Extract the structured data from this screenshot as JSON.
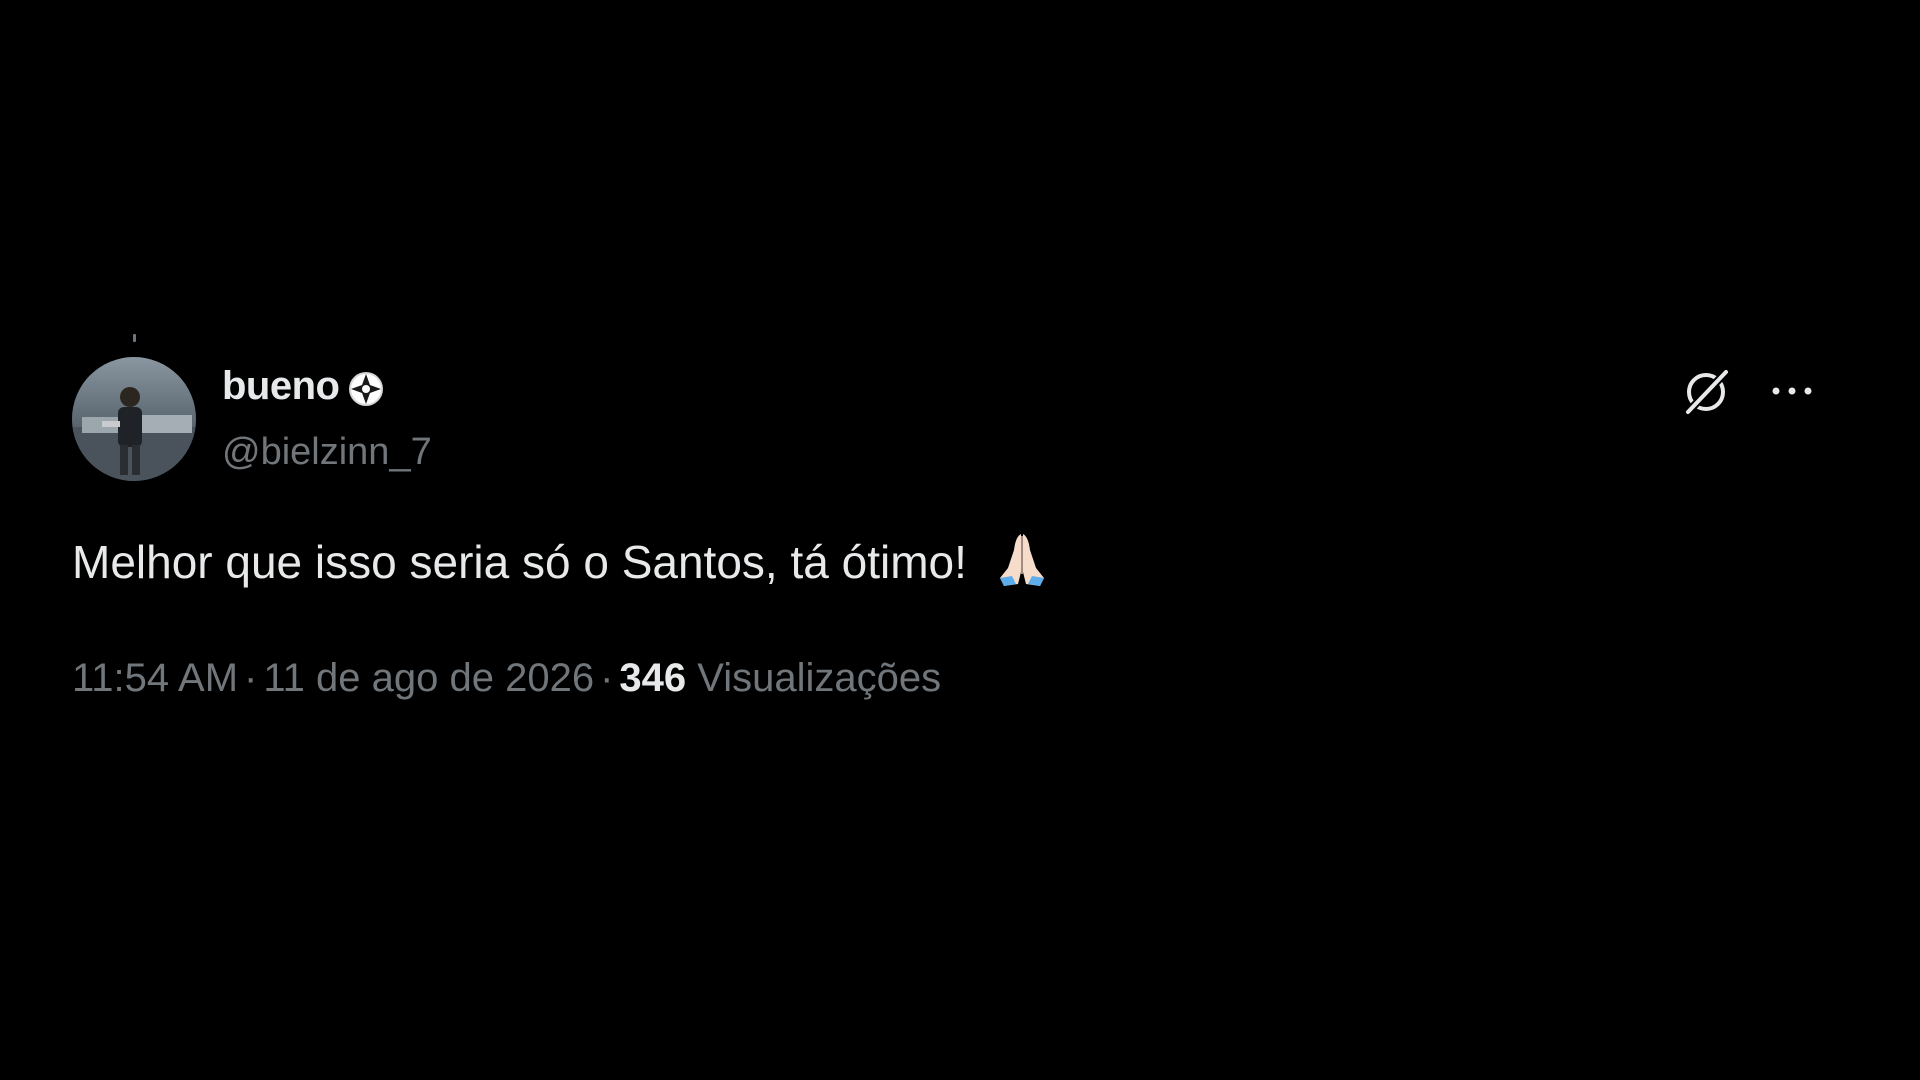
{
  "author": {
    "display_name": "bueno",
    "handle": "@bielzinn_7",
    "avatar_icon": "profile-photo",
    "badge_icon": "club-crest-icon"
  },
  "tweet": {
    "text": "Melhor que isso seria só o Santos, tá ótimo!",
    "emoji": "🙏🏻"
  },
  "meta": {
    "time": "11:54 AM",
    "separator": "·",
    "date": "11 de ago de 2026",
    "views_count": "346",
    "views_label": "Visualizações"
  },
  "actions": {
    "grok_icon": "grok-icon",
    "more_icon": "more-options-icon"
  },
  "colors": {
    "background": "#000000",
    "primary_text": "#e7e9ea",
    "secondary_text": "#71767b"
  }
}
